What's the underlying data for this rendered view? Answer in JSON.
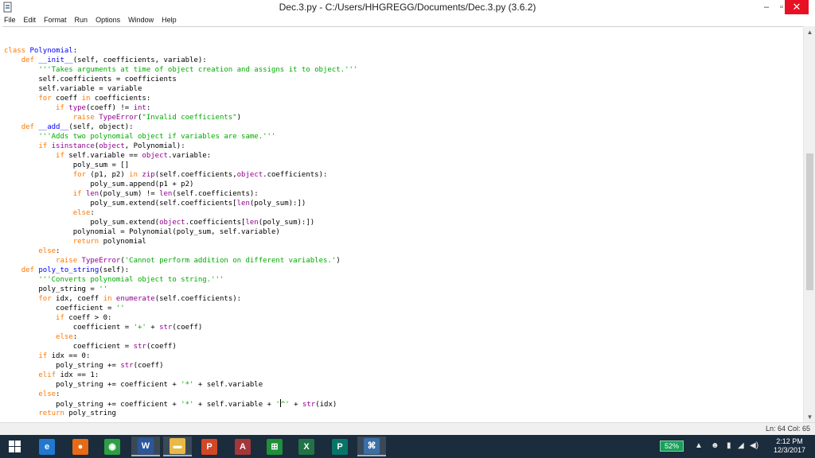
{
  "window": {
    "title": "Dec.3.py - C:/Users/HHGREGG/Documents/Dec.3.py (3.6.2)",
    "controls": {
      "minimize": "–",
      "maximize": "▫",
      "close": "✕"
    }
  },
  "menu": [
    "File",
    "Edit",
    "Format",
    "Run",
    "Options",
    "Window",
    "Help"
  ],
  "editor": {
    "lines": [
      [
        [
          "kw",
          "class "
        ],
        [
          "def",
          "Polynomial"
        ],
        [
          "t",
          ":"
        ]
      ],
      [
        [
          "t",
          "    "
        ],
        [
          "kw",
          "def "
        ],
        [
          "def",
          "__init__"
        ],
        [
          "t",
          "(self, coefficients, variable):"
        ]
      ],
      [
        [
          "t",
          "        "
        ],
        [
          "str",
          "'''Takes arguments at time of object creation and assigns it to object.'''"
        ]
      ],
      [
        [
          "t",
          "        self.coefficients = coefficients"
        ]
      ],
      [
        [
          "t",
          "        self.variable = variable"
        ]
      ],
      [
        [
          "t",
          "        "
        ],
        [
          "kw",
          "for"
        ],
        [
          "t",
          " coeff "
        ],
        [
          "kw",
          "in"
        ],
        [
          "t",
          " coefficients:"
        ]
      ],
      [
        [
          "t",
          "            "
        ],
        [
          "kw",
          "if"
        ],
        [
          "t",
          " "
        ],
        [
          "bi",
          "type"
        ],
        [
          "t",
          "(coeff) != "
        ],
        [
          "bi",
          "int"
        ],
        [
          "t",
          ":"
        ]
      ],
      [
        [
          "t",
          "                "
        ],
        [
          "kw",
          "raise"
        ],
        [
          "t",
          " "
        ],
        [
          "bi",
          "TypeError"
        ],
        [
          "t",
          "("
        ],
        [
          "str",
          "\"Invalid coefficients\""
        ],
        [
          "t",
          ")"
        ]
      ],
      [
        [
          "t",
          "    "
        ],
        [
          "kw",
          "def "
        ],
        [
          "def",
          "__add__"
        ],
        [
          "t",
          "(self, object):"
        ]
      ],
      [
        [
          "t",
          "        "
        ],
        [
          "str",
          "'''Adds two polynomial object if variables are same.'''"
        ]
      ],
      [
        [
          "t",
          "        "
        ],
        [
          "kw",
          "if"
        ],
        [
          "t",
          " "
        ],
        [
          "bi",
          "isinstance"
        ],
        [
          "t",
          "("
        ],
        [
          "bi",
          "object"
        ],
        [
          "t",
          ", Polynomial):"
        ]
      ],
      [
        [
          "t",
          "            "
        ],
        [
          "kw",
          "if"
        ],
        [
          "t",
          " self.variable == "
        ],
        [
          "bi",
          "object"
        ],
        [
          "t",
          ".variable:"
        ]
      ],
      [
        [
          "t",
          "                poly_sum = []"
        ]
      ],
      [
        [
          "t",
          "                "
        ],
        [
          "kw",
          "for"
        ],
        [
          "t",
          " (p1, p2) "
        ],
        [
          "kw",
          "in"
        ],
        [
          "t",
          " "
        ],
        [
          "bi",
          "zip"
        ],
        [
          "t",
          "(self.coefficients,"
        ],
        [
          "bi",
          "object"
        ],
        [
          "t",
          ".coefficients):"
        ]
      ],
      [
        [
          "t",
          "                    poly_sum.append(p1 + p2)"
        ]
      ],
      [
        [
          "t",
          "                "
        ],
        [
          "kw",
          "if"
        ],
        [
          "t",
          " "
        ],
        [
          "bi",
          "len"
        ],
        [
          "t",
          "(poly_sum) != "
        ],
        [
          "bi",
          "len"
        ],
        [
          "t",
          "(self.coefficients):"
        ]
      ],
      [
        [
          "t",
          "                    poly_sum.extend(self.coefficients["
        ],
        [
          "bi",
          "len"
        ],
        [
          "t",
          "(poly_sum):])"
        ]
      ],
      [
        [
          "t",
          "                "
        ],
        [
          "kw",
          "else"
        ],
        [
          "t",
          ":"
        ]
      ],
      [
        [
          "t",
          "                    poly_sum.extend("
        ],
        [
          "bi",
          "object"
        ],
        [
          "t",
          ".coefficients["
        ],
        [
          "bi",
          "len"
        ],
        [
          "t",
          "(poly_sum):])"
        ]
      ],
      [
        [
          "t",
          "                polynomial = Polynomial(poly_sum, self.variable)"
        ]
      ],
      [
        [
          "t",
          "                "
        ],
        [
          "kw",
          "return"
        ],
        [
          "t",
          " polynomial"
        ]
      ],
      [
        [
          "t",
          "        "
        ],
        [
          "kw",
          "else"
        ],
        [
          "t",
          ":"
        ]
      ],
      [
        [
          "t",
          "            "
        ],
        [
          "kw",
          "raise"
        ],
        [
          "t",
          " "
        ],
        [
          "bi",
          "TypeError"
        ],
        [
          "t",
          "("
        ],
        [
          "str",
          "'Cannot perform addition on different variables.'"
        ],
        [
          "t",
          ")"
        ]
      ],
      [
        [
          "t",
          "    "
        ],
        [
          "kw",
          "def "
        ],
        [
          "def",
          "poly_to_string"
        ],
        [
          "t",
          "(self):"
        ]
      ],
      [
        [
          "t",
          "        "
        ],
        [
          "str",
          "'''Converts polynomial object to string.'''"
        ]
      ],
      [
        [
          "t",
          "        poly_string = "
        ],
        [
          "str",
          "''"
        ]
      ],
      [
        [
          "t",
          "        "
        ],
        [
          "kw",
          "for"
        ],
        [
          "t",
          " idx, coeff "
        ],
        [
          "kw",
          "in"
        ],
        [
          "t",
          " "
        ],
        [
          "bi",
          "enumerate"
        ],
        [
          "t",
          "(self.coefficients):"
        ]
      ],
      [
        [
          "t",
          "            coefficient = "
        ],
        [
          "str",
          "''"
        ]
      ],
      [
        [
          "t",
          "            "
        ],
        [
          "kw",
          "if"
        ],
        [
          "t",
          " coeff > 0:"
        ]
      ],
      [
        [
          "t",
          "                coefficient = "
        ],
        [
          "str",
          "'+'"
        ],
        [
          "t",
          " + "
        ],
        [
          "bi",
          "str"
        ],
        [
          "t",
          "(coeff)"
        ]
      ],
      [
        [
          "t",
          "            "
        ],
        [
          "kw",
          "else"
        ],
        [
          "t",
          ":"
        ]
      ],
      [
        [
          "t",
          "                coefficient = "
        ],
        [
          "bi",
          "str"
        ],
        [
          "t",
          "(coeff)"
        ]
      ],
      [
        [
          "t",
          "        "
        ],
        [
          "kw",
          "if"
        ],
        [
          "t",
          " idx == 0:"
        ]
      ],
      [
        [
          "t",
          "            poly_string += "
        ],
        [
          "bi",
          "str"
        ],
        [
          "t",
          "(coeff)"
        ]
      ],
      [
        [
          "t",
          "        "
        ],
        [
          "kw",
          "elif"
        ],
        [
          "t",
          " idx == 1:"
        ]
      ],
      [
        [
          "t",
          "            poly_string += coefficient + "
        ],
        [
          "str",
          "'*'"
        ],
        [
          "t",
          " + self.variable"
        ]
      ],
      [
        [
          "t",
          "        "
        ],
        [
          "kw",
          "else"
        ],
        [
          "t",
          ":"
        ]
      ],
      [
        [
          "t",
          "            poly_string += coefficient + "
        ],
        [
          "str",
          "'*'"
        ],
        [
          "t",
          " + self.variable + "
        ],
        [
          "str",
          "'"
        ],
        [
          "caret",
          ""
        ],
        [
          "str",
          "^'"
        ],
        [
          "t",
          " + "
        ],
        [
          "bi",
          "str"
        ],
        [
          "t",
          "(idx)"
        ]
      ],
      [
        [
          "t",
          "        "
        ],
        [
          "kw",
          "return"
        ],
        [
          "t",
          " poly_string"
        ]
      ]
    ]
  },
  "status": {
    "position": "Ln: 64   Col: 65"
  },
  "taskbar": {
    "battery": "52%",
    "time": "2:12 PM",
    "date": "12/3/2017",
    "apps": [
      {
        "name": "edge",
        "glyph": "e",
        "color": "#1f78d1"
      },
      {
        "name": "firefox",
        "glyph": "●",
        "color": "#e86a17"
      },
      {
        "name": "chrome",
        "glyph": "◉",
        "color": "#2c9f45"
      },
      {
        "name": "word",
        "glyph": "W",
        "color": "#2b579a"
      },
      {
        "name": "file-explorer",
        "glyph": "▬",
        "color": "#e8b945"
      },
      {
        "name": "powerpoint",
        "glyph": "P",
        "color": "#d24726"
      },
      {
        "name": "access",
        "glyph": "A",
        "color": "#a4373a"
      },
      {
        "name": "store",
        "glyph": "⊞",
        "color": "#1f8f3a"
      },
      {
        "name": "excel",
        "glyph": "X",
        "color": "#217346"
      },
      {
        "name": "publisher",
        "glyph": "P",
        "color": "#077568"
      },
      {
        "name": "python",
        "glyph": "⌘",
        "color": "#3a6fa8"
      }
    ]
  }
}
